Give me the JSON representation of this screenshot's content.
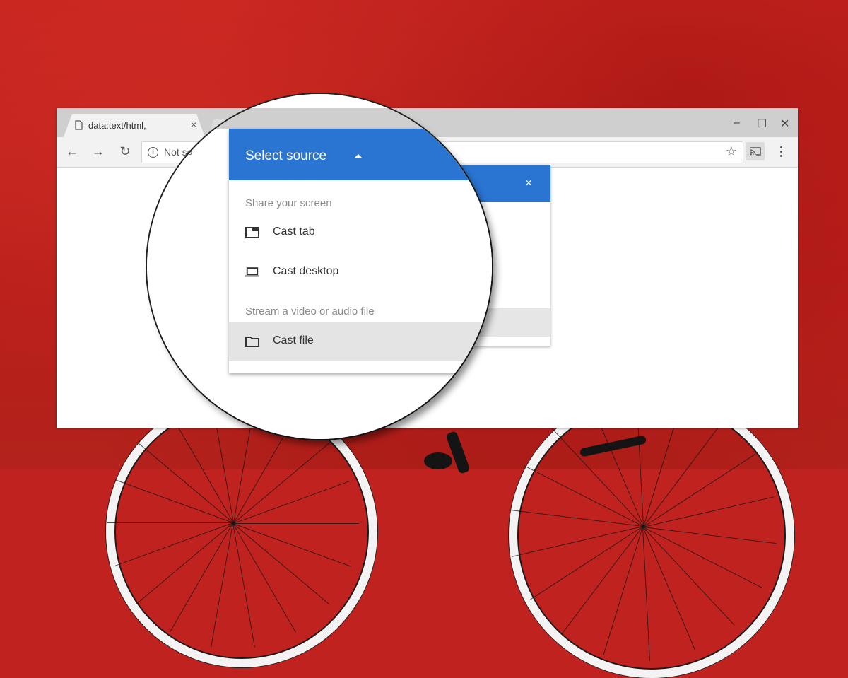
{
  "browser": {
    "tab": {
      "title": "data:text/html,",
      "close_glyph": "×",
      "favicon": "page-icon"
    },
    "window_controls": {
      "minimize": "–",
      "maximize": "☐",
      "close": "✕"
    },
    "toolbar": {
      "back": "←",
      "forward": "→",
      "reload": "↻",
      "security_glyph": "i",
      "url_text": "Not se",
      "url_text_full_in_lens": "Not se",
      "bookmark_glyph": "☆"
    }
  },
  "cast_dialog": {
    "close_glyph": "×"
  },
  "source_menu": {
    "title": "Select source",
    "sections": [
      {
        "heading": "Share your screen"
      },
      {
        "heading": "Stream a video or audio file"
      }
    ],
    "items": [
      {
        "label": "Cast tab",
        "icon": "tab-icon",
        "highlighted": false
      },
      {
        "label": "Cast desktop",
        "icon": "laptop-icon",
        "highlighted": false
      },
      {
        "label": "Cast file",
        "icon": "folder-icon",
        "highlighted": true
      }
    ]
  },
  "colors": {
    "accent_blue": "#2a74d2",
    "background_red": "#c0231f",
    "highlight_gray": "#e4e4e4"
  }
}
